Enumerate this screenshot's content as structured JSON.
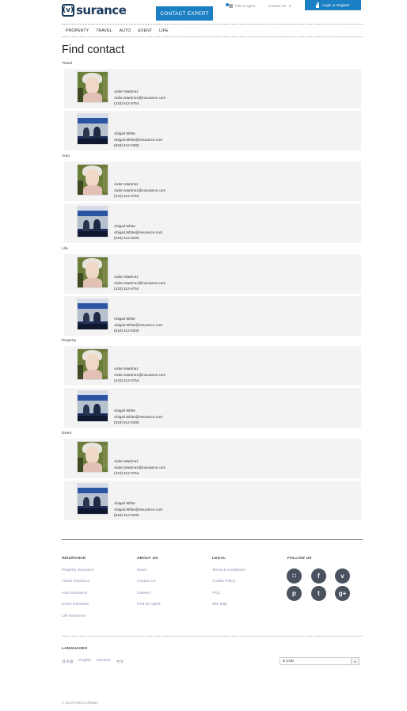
{
  "header": {
    "logo_mark": "(v)",
    "logo_text": "surance",
    "contact_expert": "CONTACT EXPERT",
    "find_agent": "Find a Agent",
    "contact_us": "Contact Us",
    "login": "Login or Register"
  },
  "nav": [
    "PROPERTY",
    "TRAVEL",
    "AUTO",
    "EVENT",
    "LIFE"
  ],
  "page_title": "Find contact",
  "sections": [
    {
      "label": "Travel",
      "contacts": [
        {
          "name": "Aiden Martinez",
          "email": "Aiden.Martinez@insurance.com",
          "phone": "(415) 512-6754",
          "photo": "girl-photo"
        },
        {
          "name": "Abigail White",
          "email": "Abigail.White@insurance.com",
          "phone": "(818) 512-5335",
          "photo": "group-photo"
        }
      ]
    },
    {
      "label": "Auto",
      "contacts": [
        {
          "name": "Aiden Martinez",
          "email": "Aiden.Martinez@insurance.com",
          "phone": "(415) 512-6754",
          "photo": "girl-photo"
        },
        {
          "name": "Abigail White",
          "email": "Abigail.White@insurance.com",
          "phone": "(818) 512-5335",
          "photo": "group-photo"
        }
      ]
    },
    {
      "label": "Life",
      "contacts": [
        {
          "name": "Aiden Martinez",
          "email": "Aiden.Martinez@insurance.com",
          "phone": "(415) 512-6754",
          "photo": "girl-photo"
        },
        {
          "name": "Abigail White",
          "email": "Abigail.White@insurance.com",
          "phone": "(818) 512-5335",
          "photo": "group-photo"
        }
      ]
    },
    {
      "label": "Property",
      "contacts": [
        {
          "name": "Aiden Martinez",
          "email": "Aiden.Martinez@insurance.com",
          "phone": "(415) 512-6754",
          "photo": "girl-photo"
        },
        {
          "name": "Abigail White",
          "email": "Abigail.White@insurance.com",
          "phone": "(818) 512-5335",
          "photo": "group-photo"
        }
      ]
    },
    {
      "label": "Event",
      "contacts": [
        {
          "name": "Aiden Martinez",
          "email": "Aiden.Martinez@insurance.com",
          "phone": "(415) 512-6754",
          "photo": "girl-photo"
        },
        {
          "name": "Abigail White",
          "email": "Abigail.White@insurance.com",
          "phone": "(818) 512-5335",
          "photo": "group-photo"
        }
      ]
    }
  ],
  "footer": {
    "insurance": {
      "heading": "INSURANCE",
      "links": [
        "Property Insurance",
        "Travel Insurance",
        "Auto Insurance",
        "Event Insurance",
        "Life Insurance"
      ]
    },
    "about": {
      "heading": "ABOUT US",
      "links": [
        "News",
        "Contact Us",
        "Careers",
        "Find an Agent"
      ]
    },
    "legal": {
      "heading": "LEGAL",
      "links": [
        "Terms & Conditions",
        "Cookie Policy",
        "FAQ",
        "Site Map"
      ]
    },
    "follow": {
      "heading": "FOLLOW US",
      "icons": [
        {
          "name": "rss-icon",
          "glyph": "∷"
        },
        {
          "name": "facebook-icon",
          "glyph": "f"
        },
        {
          "name": "vimeo-icon",
          "glyph": "v"
        },
        {
          "name": "pinterest-icon",
          "glyph": "p"
        },
        {
          "name": "twitter-icon",
          "glyph": "t"
        },
        {
          "name": "google-plus-icon",
          "glyph": "g+"
        }
      ]
    },
    "languages_heading": "LANGUAGES",
    "languages": [
      "日本語",
      "English",
      "Deutsch",
      "中文"
    ],
    "currency": "$ USD",
    "copyright": "© 2013 hybris software"
  },
  "colors": {
    "brand": "#1b7fc4",
    "logo": "#1b3a5c",
    "card_bg": "#f3f3f3",
    "link": "#8c8cb0"
  }
}
